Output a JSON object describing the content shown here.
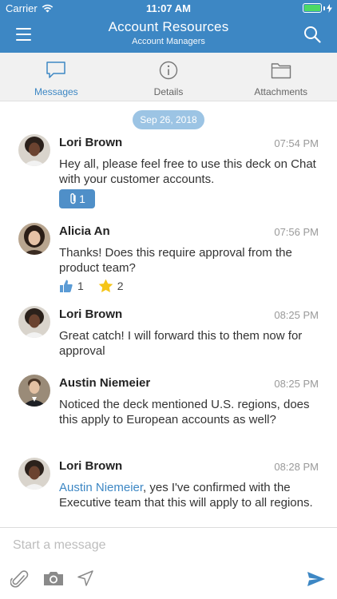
{
  "status_bar": {
    "carrier": "Carrier",
    "time": "11:07 AM",
    "battery_color": "#4cd964"
  },
  "nav": {
    "menu_icon": "hamburger-icon",
    "title": "Account Resources",
    "subtitle": "Account Managers",
    "search_icon": "search-icon",
    "bar_color": "#3d87c4"
  },
  "tabs": [
    {
      "label": "Messages",
      "icon": "chat-bubble-icon",
      "active": true
    },
    {
      "label": "Details",
      "icon": "info-icon",
      "active": false
    },
    {
      "label": "Attachments",
      "icon": "folder-icon",
      "active": false
    }
  ],
  "date_separator": "Sep 26, 2018",
  "messages": [
    {
      "name": "Lori Brown",
      "time": "07:54 PM",
      "text": "Hey all, please feel free to use this deck on Chat with your customer accounts.",
      "attachments": "1"
    },
    {
      "name": "Alicia An",
      "time": "07:56 PM",
      "text": "Thanks! Does this require approval from the product team?",
      "reactions": [
        {
          "icon": "thumbs-up-icon",
          "count": "1"
        },
        {
          "icon": "star-icon",
          "count": "2"
        }
      ]
    },
    {
      "name": "Lori Brown",
      "time": "08:25 PM",
      "text": "Great catch! I will forward this to them now for approval"
    },
    {
      "name": "Austin Niemeier",
      "time": "08:25 PM",
      "text": "Noticed the deck mentioned U.S. regions, does this apply to European accounts as well?"
    },
    {
      "name": "Lori Brown",
      "time": "08:28 PM",
      "mention": "Austin Niemeier",
      "text": ", yes I've confirmed with the Executive team that this will apply to all regions."
    }
  ],
  "composer": {
    "placeholder": "Start a message",
    "tools": [
      "paperclip-icon",
      "camera-icon",
      "location-arrow-icon"
    ],
    "send_icon": "send-icon"
  }
}
